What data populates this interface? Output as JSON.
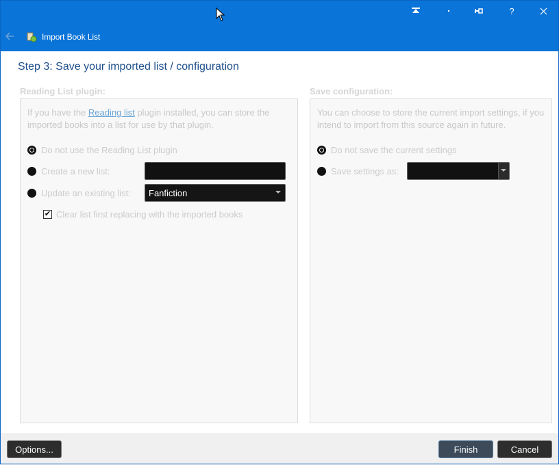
{
  "window": {
    "title": "Import Book List",
    "controls": [
      "restore-top",
      "minimize",
      "pin",
      "help",
      "close"
    ],
    "control_glyphs": {
      "top": "⤒",
      "min": "·",
      "pin": "⇤",
      "help": "?",
      "close": "✕"
    }
  },
  "step_title": "Step 3: Save your imported list / configuration",
  "reading_list": {
    "label": "Reading List plugin:",
    "desc_pre": "If you have the ",
    "desc_link": "Reading list",
    "desc_post": " plugin installed, you can store the imported books into a list for use by that plugin.",
    "opt_none": "Do not use the Reading List plugin",
    "opt_new": "Create a new list:",
    "opt_update": "Update an existing list:",
    "existing_list_value": "Fanfiction",
    "clear_label": "Clear list first replacing with the imported books",
    "clear_checked": true
  },
  "save_config": {
    "label": "Save configuration:",
    "desc": "You can choose to store the current import settings, if you intend to import from this source again in future.",
    "opt_none": "Do not save the current settings",
    "opt_save": "Save settings as:"
  },
  "footer": {
    "options_label": "Options...",
    "finish_label": "Finish",
    "cancel_label": "Cancel"
  },
  "colors": {
    "titlebar": "#0a74d8",
    "step_title": "#1e4f8c"
  }
}
